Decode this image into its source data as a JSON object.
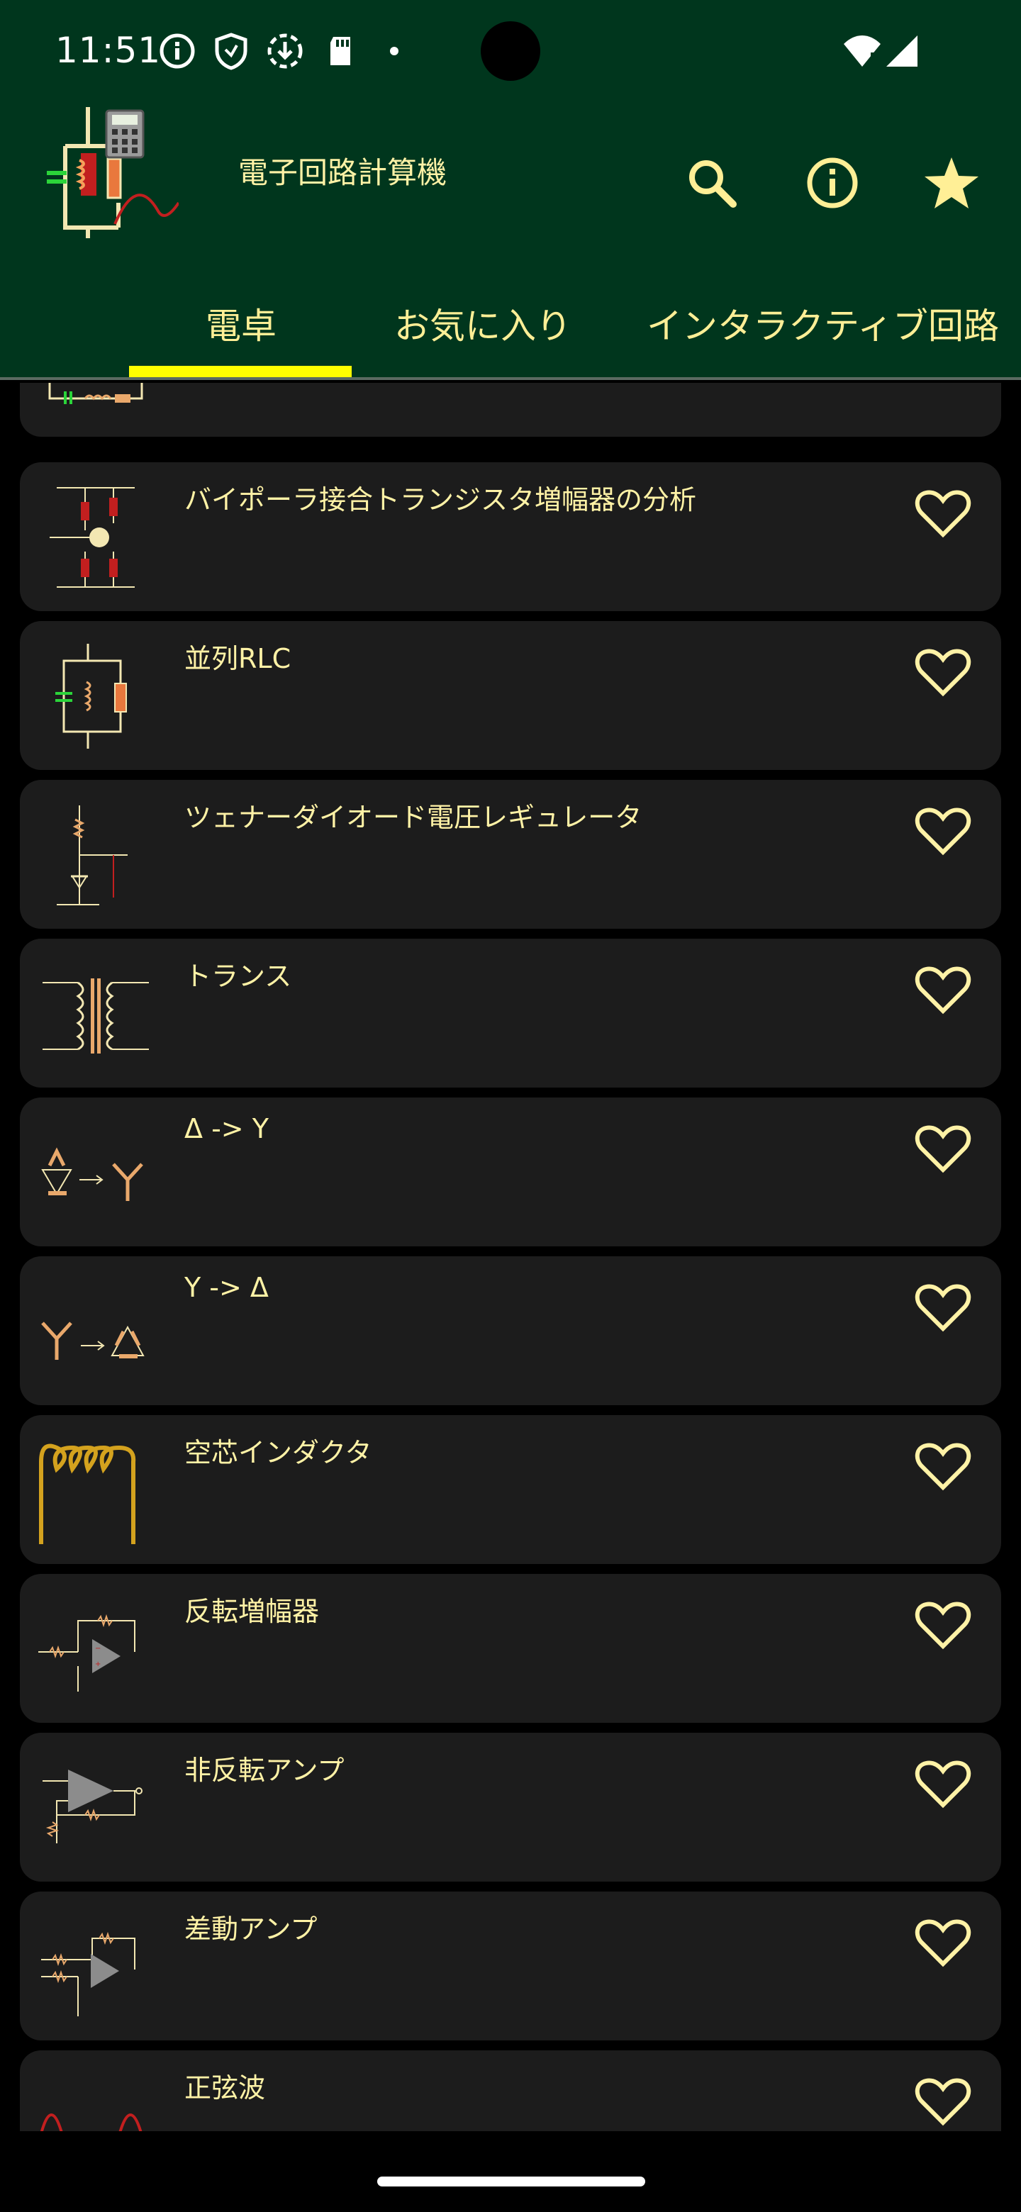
{
  "status_bar": {
    "time": "11:51"
  },
  "app": {
    "title": "電子回路計算機",
    "tabs": [
      {
        "label": "電卓",
        "selected": true
      },
      {
        "label": "お気に入り",
        "selected": false
      },
      {
        "label": "インタラクティブ回路",
        "selected": false
      }
    ],
    "actions": [
      "search-icon",
      "info-icon",
      "star-icon"
    ]
  },
  "calculators": [
    {
      "title": "",
      "favorite": false
    },
    {
      "title": "バイポーラ接合トランジスタ増幅器の分析",
      "favorite": false
    },
    {
      "title": "並列RLC",
      "favorite": false
    },
    {
      "title": "ツェナーダイオード電圧レギュレータ",
      "favorite": false
    },
    {
      "title": "トランス",
      "favorite": false
    },
    {
      "title": "Δ -> Y",
      "favorite": false
    },
    {
      "title": "Y -> Δ",
      "favorite": false
    },
    {
      "title": "空芯インダクタ",
      "favorite": false
    },
    {
      "title": "反転増幅器",
      "favorite": false
    },
    {
      "title": "非反転アンプ",
      "favorite": false
    },
    {
      "title": "差動アンプ",
      "favorite": false
    },
    {
      "title": "正弦波",
      "favorite": false
    }
  ],
  "colors": {
    "appbar": "#00361d",
    "accent": "#ffff00",
    "text": "#fff2a6",
    "card": "#1c1c1c"
  }
}
